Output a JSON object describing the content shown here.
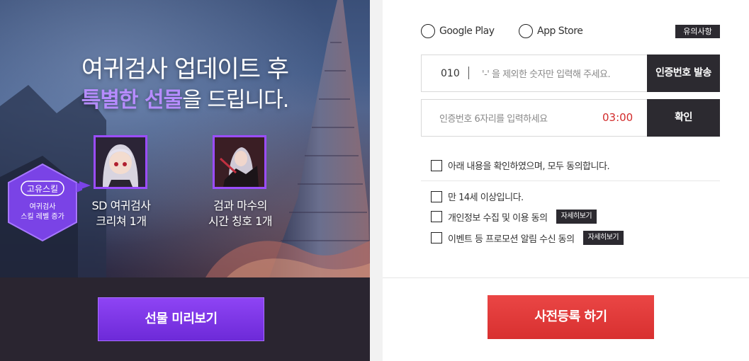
{
  "promo": {
    "headline_line1": "여귀검사 업데이트 후",
    "headline_highlight": "특별한 선물",
    "headline_rest": "을 드립니다.",
    "badge": {
      "title": "고유스킬",
      "desc_line1": "여귀검사",
      "desc_line2": "스킬 레벨 증가"
    },
    "items": [
      {
        "icon": "sd-ghost-swordswoman-creature-icon",
        "label_line1": "SD 여귀검사",
        "label_line2": "크리쳐 1개"
      },
      {
        "icon": "sword-and-demon-title-icon",
        "label_line1": "검과 마수의",
        "label_line2": "시간 칭호 1개"
      }
    ],
    "preview_button": "선물 미리보기"
  },
  "form": {
    "store_options": [
      "Google Play",
      "App Store"
    ],
    "notice_label": "유의사항",
    "phone_prefix": "010",
    "phone_placeholder": "'-' 을 제외한 숫자만 입력해 주세요.",
    "send_code_button": "인증번호 발송",
    "code_placeholder": "인증번호 6자리를 입력하세요",
    "timer": "03:00",
    "confirm_button": "확인",
    "agree_all": "아래 내용을 확인하였으며, 모두 동의합니다.",
    "agreements": [
      {
        "label": "만 14세 이상입니다.",
        "detail": ""
      },
      {
        "label": "개인정보 수집 및 이용 동의",
        "detail": "자세히보기"
      },
      {
        "label": "이벤트 등 프로모션 알림 수신 동의",
        "detail": "자세히보기"
      }
    ],
    "register_button": "사전등록 하기"
  },
  "colors": {
    "accent_purple": "#9b4dff",
    "highlight_purple": "#b68cff",
    "register_red": "#e03a3a",
    "dark_button": "#2c2a30",
    "timer_red": "#d22b2b"
  }
}
